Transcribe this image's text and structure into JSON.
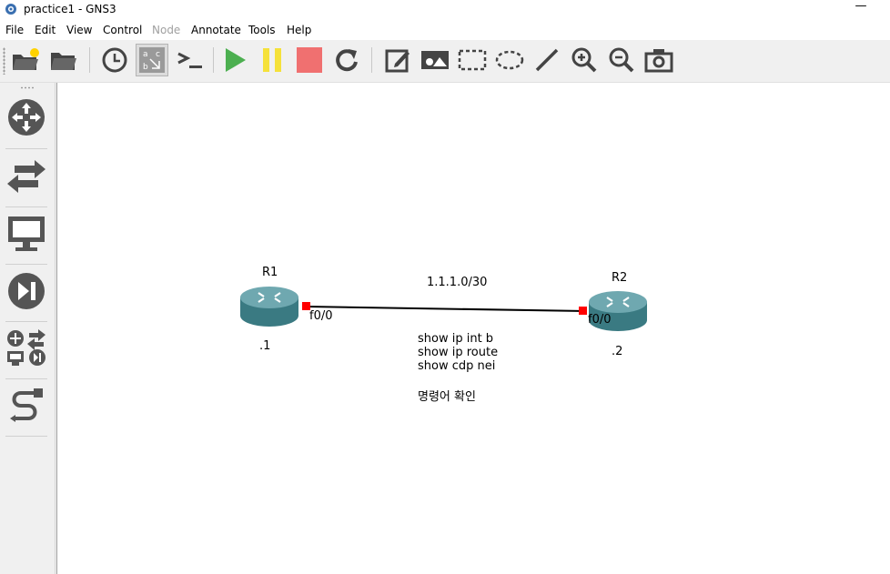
{
  "window": {
    "title": "practice1 - GNS3",
    "minimize": "—"
  },
  "menu": [
    {
      "label": "File",
      "disabled": false
    },
    {
      "label": "Edit",
      "disabled": false
    },
    {
      "label": "View",
      "disabled": false
    },
    {
      "label": "Control",
      "disabled": false
    },
    {
      "label": "Node",
      "disabled": true
    },
    {
      "label": "Annotate",
      "disabled": false
    },
    {
      "label": "Tools",
      "disabled": false
    },
    {
      "label": "Help",
      "disabled": false
    }
  ],
  "toolbar": {
    "icons": [
      "new-project-icon",
      "open-project-icon",
      "snapshot-clock-icon",
      "show-interface-labels-icon",
      "console-icon",
      "start-icon",
      "pause-icon",
      "stop-icon",
      "reload-icon",
      "add-note-icon",
      "insert-picture-icon",
      "draw-rectangle-icon",
      "draw-ellipse-icon",
      "draw-line-icon",
      "zoom-in-icon",
      "zoom-out-icon",
      "screenshot-icon"
    ],
    "colors": {
      "start": "#4caf50",
      "pause": "#f5e13a",
      "stop": "#f07070"
    }
  },
  "sidebar": {
    "icons": [
      "routers-icon",
      "switches-icon",
      "end-devices-icon",
      "security-devices-icon",
      "all-devices-icon",
      "add-link-icon"
    ]
  },
  "topology": {
    "nodes": [
      {
        "name": "R1",
        "address": ".1",
        "interface": "f0/0"
      },
      {
        "name": "R2",
        "address": ".2",
        "interface": "f0/0"
      }
    ],
    "link": {
      "subnet": "1.1.1.0/30",
      "port_color": "#ff0000"
    },
    "note": {
      "lines": [
        "show ip int b",
        "show ip route",
        "show cdp nei"
      ],
      "caption": "명령어 확인"
    }
  }
}
